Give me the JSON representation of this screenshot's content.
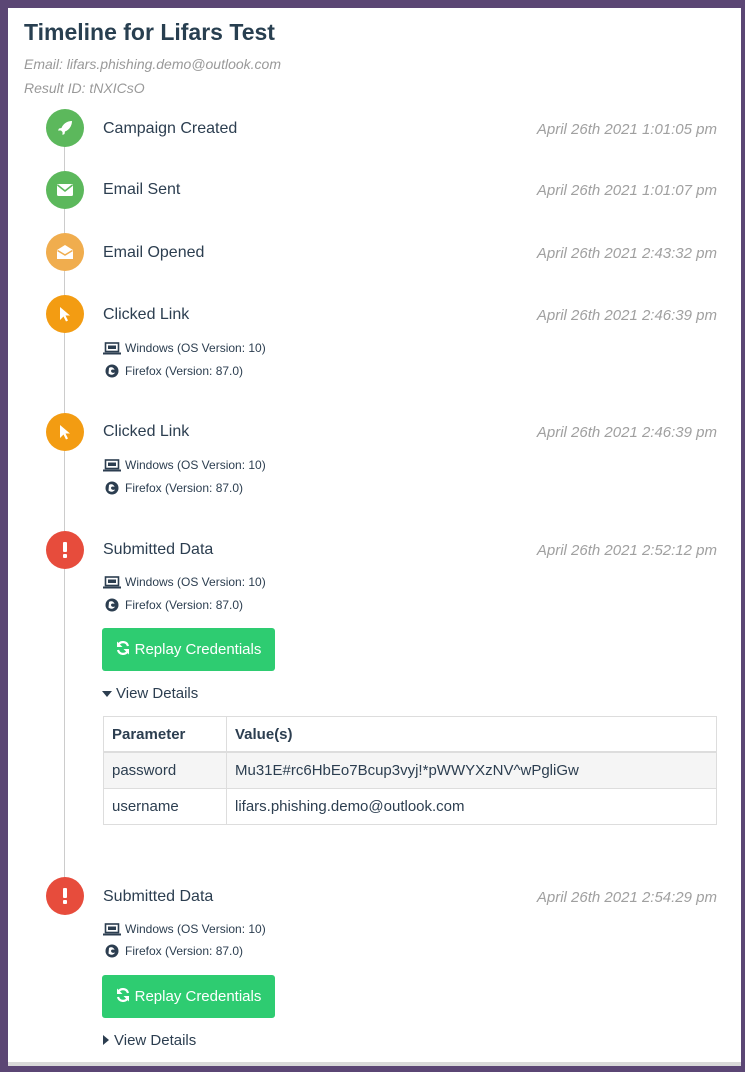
{
  "header": {
    "title": "Timeline for Lifars Test",
    "email": "Email: lifars.phishing.demo@outlook.com",
    "result_id": "Result ID: tNXICsO"
  },
  "events": [
    {
      "label": "Campaign Created",
      "time": "April 26th 2021 1:01:05 pm",
      "icon": "rocket-icon",
      "color": "#5cb85c"
    },
    {
      "label": "Email Sent",
      "time": "April 26th 2021 1:01:07 pm",
      "icon": "envelope-icon",
      "color": "#5cb85c"
    },
    {
      "label": "Email Opened",
      "time": "April 26th 2021 2:43:32 pm",
      "icon": "envelope-open-icon",
      "color": "#f0ad4e"
    },
    {
      "label": "Clicked Link",
      "time": "April 26th 2021 2:46:39 pm",
      "icon": "mouse-pointer-icon",
      "color": "#f39c12",
      "os": "Windows (OS Version: 10)",
      "browser": "Firefox (Version: 87.0)"
    },
    {
      "label": "Clicked Link",
      "time": "April 26th 2021 2:46:39 pm",
      "icon": "mouse-pointer-icon",
      "color": "#f39c12",
      "os": "Windows (OS Version: 10)",
      "browser": "Firefox (Version: 87.0)"
    },
    {
      "label": "Submitted Data",
      "time": "April 26th 2021 2:52:12 pm",
      "icon": "exclamation-icon",
      "color": "#e74c3c",
      "os": "Windows (OS Version: 10)",
      "browser": "Firefox (Version: 87.0)",
      "replay_label": "Replay Credentials",
      "details_label": "View Details"
    },
    {
      "label": "Submitted Data",
      "time": "April 26th 2021 2:54:29 pm",
      "icon": "exclamation-icon",
      "color": "#e74c3c",
      "os": "Windows (OS Version: 10)",
      "browser": "Firefox (Version: 87.0)",
      "replay_label": "Replay Credentials",
      "details_label": "View Details"
    }
  ],
  "details_table": {
    "headers": [
      "Parameter",
      "Value(s)"
    ],
    "rows": [
      [
        "password",
        "Mu31E#rc6HbEo7Bcup3vyj!*pWWYXzNV^wPgliGw"
      ],
      [
        "username",
        "lifars.phishing.demo@outlook.com"
      ]
    ]
  }
}
